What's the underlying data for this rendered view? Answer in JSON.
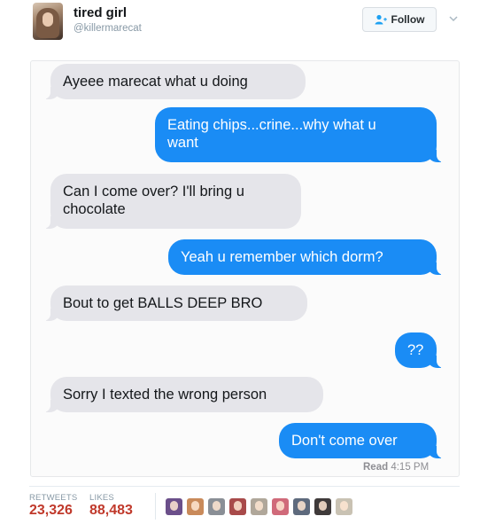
{
  "header": {
    "display_name": "tired girl",
    "handle": "@killermarecat",
    "follow_label": "Follow",
    "avatar_icon": "profile-photo",
    "follow_icon": "person-add-icon",
    "menu_icon": "chevron-down-icon"
  },
  "messages": [
    {
      "sender": "other",
      "lines": [
        "Ayeee marecat what u doing"
      ]
    },
    {
      "sender": "me",
      "lines": [
        "Eating chips...crine...why what u",
        "want"
      ]
    },
    {
      "sender": "other",
      "lines": [
        "Can I come over? I'll bring u",
        "chocolate"
      ]
    },
    {
      "sender": "me",
      "lines": [
        "Yeah u remember which dorm?"
      ]
    },
    {
      "sender": "other",
      "lines": [
        "Bout to get BALLS DEEP BRO"
      ]
    },
    {
      "sender": "me",
      "lines": [
        "??"
      ]
    },
    {
      "sender": "other",
      "lines": [
        "Sorry I texted the wrong person"
      ]
    },
    {
      "sender": "me",
      "lines": [
        "Don't come over"
      ]
    }
  ],
  "read_receipt": {
    "label": "Read",
    "time": "4:15 PM"
  },
  "stats": {
    "retweets_label": "RETWEETS",
    "retweets_value": "23,326",
    "likes_label": "LIKES",
    "likes_value": "88,483"
  },
  "colors": {
    "imessage_blue": "#1a8cf5",
    "imessage_gray": "#e5e5ea",
    "stat_value": "#c0392b"
  },
  "likers": [
    {
      "name": "liker-avatar-1",
      "color": "#6b4f8a"
    },
    {
      "name": "liker-avatar-2",
      "color": "#c98a5a"
    },
    {
      "name": "liker-avatar-3",
      "color": "#8a8f96"
    },
    {
      "name": "liker-avatar-4",
      "color": "#a84a4a"
    },
    {
      "name": "liker-avatar-5",
      "color": "#b0a79a"
    },
    {
      "name": "liker-avatar-6",
      "color": "#d06a7a"
    },
    {
      "name": "liker-avatar-7",
      "color": "#5e6a7d"
    },
    {
      "name": "liker-avatar-8",
      "color": "#3f3a3a"
    },
    {
      "name": "liker-avatar-9",
      "color": "#c9c2b3"
    }
  ]
}
